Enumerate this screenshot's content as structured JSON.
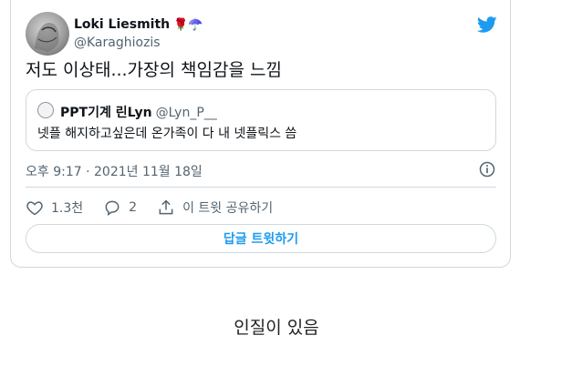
{
  "tweet": {
    "author_name": "Loki Liesmith",
    "author_emoji": "🌹☂️",
    "handle": "@Karaghiozis",
    "text": "저도 이상태...가장의 책임감을 느낌",
    "quote": {
      "name": "PPT기계 린Lyn",
      "handle": "@Lyn_P__",
      "text": "넷플 해지하고싶은데 온가족이 다 내 넷플릭스 씀"
    },
    "timestamp": "오후 9:17 · 2021년 11월 18일",
    "actions": {
      "likes": "1.3천",
      "replies": "2",
      "share_label": "이 트윗 공유하기"
    },
    "reply_button": "답글 트윗하기"
  },
  "caption": "인질이 있음",
  "colors": {
    "accent": "#1d9bf0",
    "text": "#0f1419",
    "muted": "#536471",
    "border": "#cfd9de"
  },
  "icons": [
    "twitter-bird-icon",
    "info-icon",
    "heart-icon",
    "reply-icon",
    "share-icon"
  ]
}
